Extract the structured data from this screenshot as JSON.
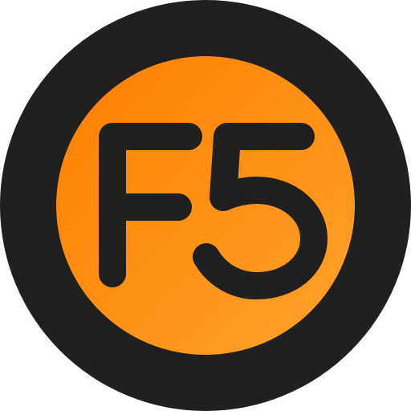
{
  "icon": {
    "name": "f5-logo-icon",
    "logo_text": "F5",
    "colors": {
      "ring": "#202020",
      "disc_start": "#ff7f00",
      "disc_end": "#ffa22a",
      "glyph": "#202020"
    }
  }
}
